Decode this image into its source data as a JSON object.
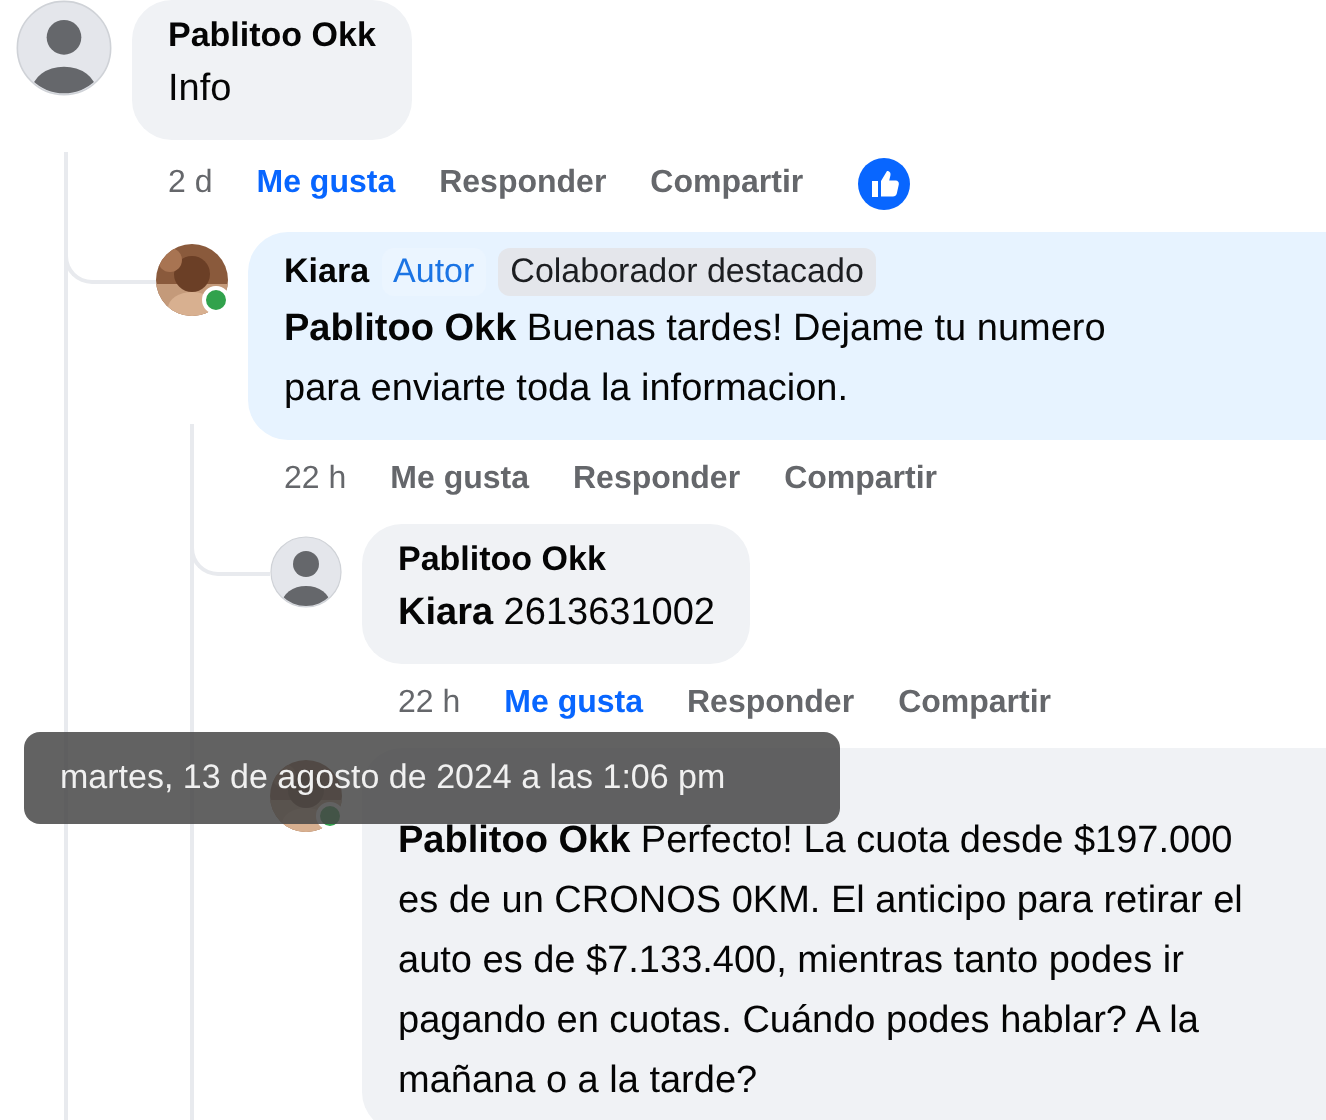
{
  "comments": [
    {
      "author": "Pablitoo Okk",
      "has_photo": false,
      "highlighted": false,
      "text": "Info",
      "time": "2 d",
      "liked": true,
      "reaction": true,
      "actions": [
        "Me gusta",
        "Responder",
        "Compartir"
      ],
      "replies": [
        {
          "author": "Kiara",
          "has_photo": true,
          "online": true,
          "highlighted": true,
          "badges": [
            {
              "label": "Autor",
              "kind": "author"
            },
            {
              "label": "Colaborador destacado",
              "kind": "top-contributor"
            }
          ],
          "text": "**Pablitoo Okk** Buenas tardes! Dejame tu numero para enviarte toda la informacion.",
          "time": "22 h",
          "liked": false,
          "actions": [
            "Me gusta",
            "Responder",
            "Compartir"
          ],
          "replies": [
            {
              "author": "Pablitoo Okk",
              "has_photo": false,
              "highlighted": false,
              "text": "**Kiara** 2613631002",
              "time": "22 h",
              "liked": true,
              "actions": [
                "Me gusta",
                "Responder",
                "Compartir"
              ]
            },
            {
              "has_photo": true,
              "online": true,
              "highlighted": false,
              "text": "**Pablitoo Okk** Perfecto! La cuota desde $197.000 es de un CRONOS 0KM. El anticipo para retirar el auto es de $7.133.400, mientras tanto podes ir pagando en cuotas. Cuándo podes hablar? A la mañana o a la tarde?"
            }
          ]
        }
      ]
    }
  ],
  "tooltip": "martes, 13 de agosto de 2024 a las 1:06 pm"
}
